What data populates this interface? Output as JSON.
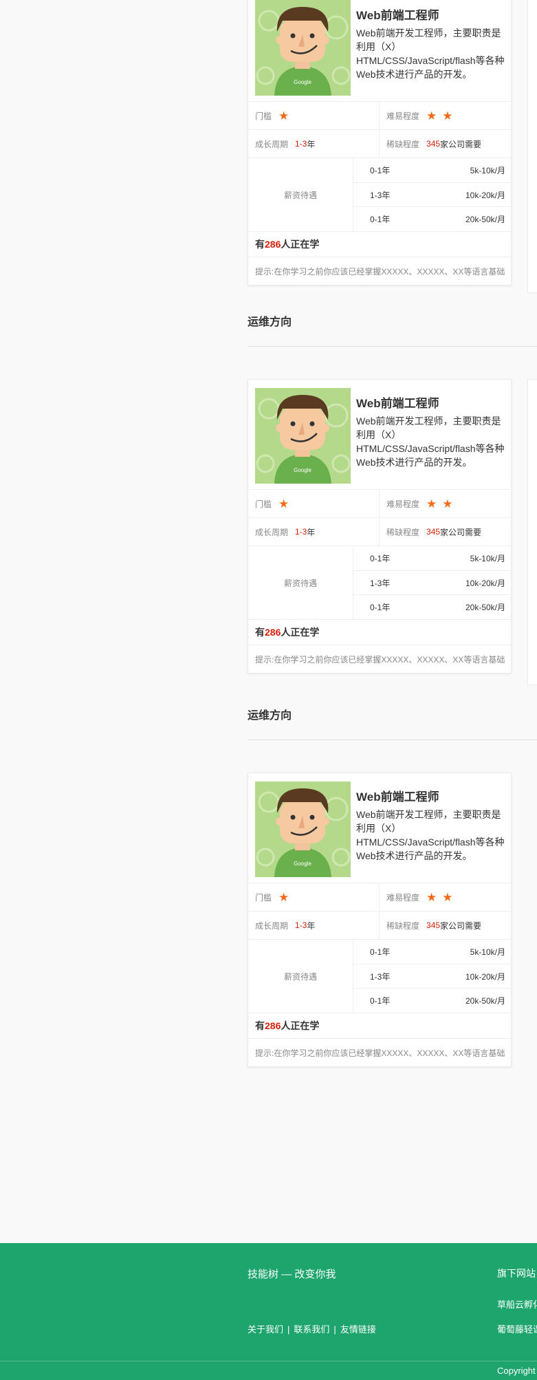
{
  "sections": [
    {
      "title": "运维方向"
    },
    {
      "title": "运维方向"
    }
  ],
  "card": {
    "title": "Web前端工程师",
    "description": "Web前端开发工程师，主要职责是利用（X）HTML/CSS/JavaScript/flash等各种Web技术进行产品的开发。",
    "avatar_icon": "avatar-boy-google-icon",
    "threshold_label": "门槛",
    "threshold_stars": 1,
    "difficulty_label": "难易程度",
    "difficulty_stars": 2,
    "star_color": "#f26c17",
    "growth_label": "成长周期",
    "growth_value": "1-3",
    "growth_unit": "年",
    "scarcity_label": "稀缺程度",
    "scarcity_value": "345",
    "scarcity_unit": "家公司需要",
    "salary_label": "薪资待遇",
    "salary_rows": [
      {
        "years": "0-1年",
        "range": "5k-10k/月"
      },
      {
        "years": "1-3年",
        "range": "10k-20k/月"
      },
      {
        "years": "0-1年",
        "range": "20k-50k/月"
      }
    ],
    "learners_prefix": "有",
    "learners_count": "286",
    "learners_suffix": "人正在学",
    "hint": "提示:在你学习之前你应该已经掌握XXXXX、XXXXX、XX等语言基础",
    "highlight_color": "#d81e06"
  },
  "footer": {
    "slogan": "技能树 — 改变你我",
    "links": [
      "关于我们",
      "联系我们",
      "友情链接"
    ],
    "right_title": "旗下网站",
    "right_items": [
      "草船云孵化器",
      "葡萄藤轻课堂"
    ],
    "copyright": "Copyright",
    "bg_color": "#1ea56e"
  }
}
